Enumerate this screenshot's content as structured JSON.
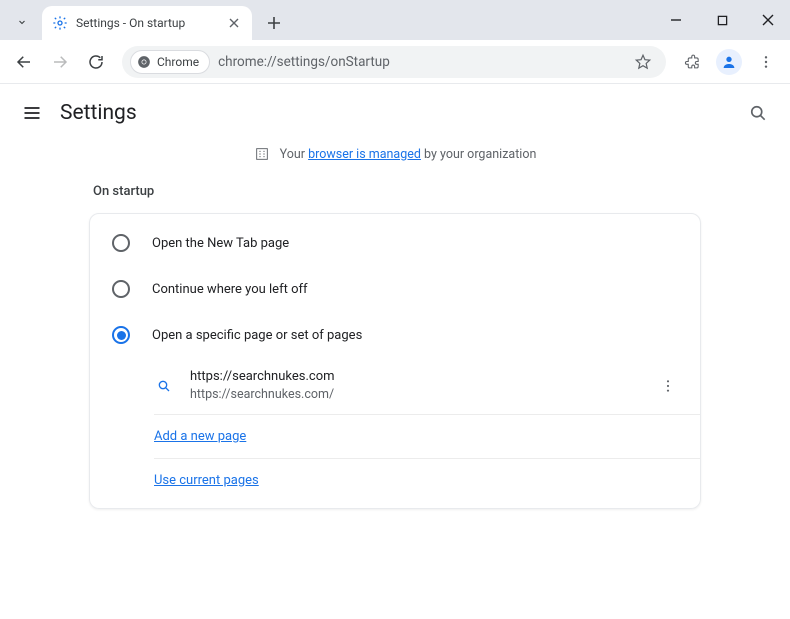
{
  "window": {
    "tab_title": "Settings - On startup"
  },
  "omnibox": {
    "chip_label": "Chrome",
    "url": "chrome://settings/onStartup"
  },
  "settings": {
    "title": "Settings",
    "managed_prefix": "Your ",
    "managed_link": "browser is managed",
    "managed_suffix": " by your organization",
    "section_label": "On startup",
    "options": {
      "new_tab": "Open the New Tab page",
      "continue": "Continue where you left off",
      "specific": "Open a specific page or set of pages"
    },
    "startup_page": {
      "title": "https://searchnukes.com",
      "url": "https://searchnukes.com/"
    },
    "links": {
      "add_page": "Add a new page",
      "use_current": "Use current pages"
    }
  }
}
